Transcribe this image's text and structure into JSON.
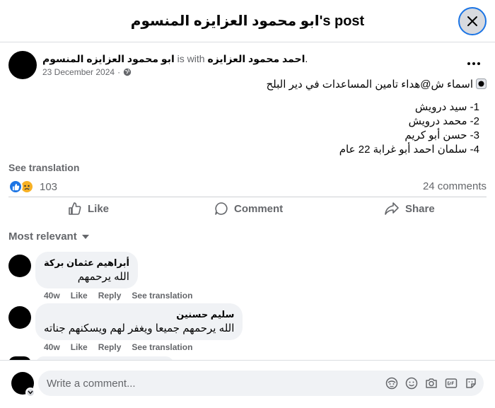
{
  "header": {
    "title": "ابو محمود العزايزه المنسوم's post"
  },
  "post": {
    "author": "ابو محمود العزايزه المنسوم",
    "with_text": "is with",
    "tagged": "احمد محمود العزايزه",
    "trailing": ".",
    "date": "23 December 2024",
    "date_sep": "·",
    "intro": "اسماء ش@هداء تامين المساعدات في دير البلح",
    "list": [
      "1- سيد درويش",
      "2- محمد درويش",
      "3- حسن أبو كريم",
      "4- سلمان احمد أبو غرابة 22 عام"
    ],
    "see_translation": "See translation",
    "reaction_count": "103",
    "comments_count": "24 comments"
  },
  "actions": {
    "like": "Like",
    "comment": "Comment",
    "share": "Share"
  },
  "sort": {
    "label": "Most relevant"
  },
  "comments": [
    {
      "name": "أبراهيم عثمان بركة",
      "text": "الله يرحمهم",
      "age": "40w",
      "like": "Like",
      "reply": "Reply",
      "translate": "See translation"
    },
    {
      "name": "سليم حسنين",
      "text": "الله يرحمهم جميعا ويغفر لهم ويسكنهم جناته",
      "age": "40w",
      "like": "Like",
      "reply": "Reply",
      "translate": "See translation"
    }
  ],
  "composer": {
    "placeholder": "Write a comment..."
  },
  "colors": {
    "accent": "#1b74e4",
    "muted": "#65676b",
    "bubble": "#f0f2f5",
    "sad": "#f7b125"
  },
  "icons": [
    "close-icon",
    "globe-icon",
    "more-icon",
    "like-icon",
    "comment-icon",
    "share-icon",
    "sticker-icon",
    "emoji-icon",
    "camera-icon",
    "gif-icon",
    "avatar-sticker-icon"
  ]
}
